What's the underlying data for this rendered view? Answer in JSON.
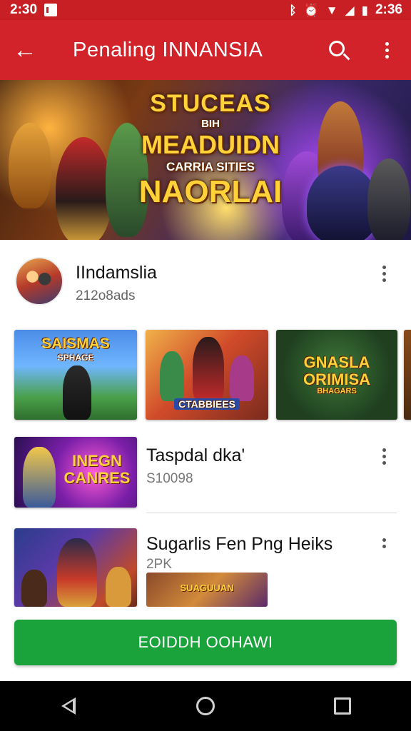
{
  "status_bar": {
    "time_left": "2:30",
    "time_right": "2:36",
    "icons": [
      "notification-icon",
      "bluetooth-icon",
      "alarm-icon",
      "wifi-icon",
      "signal-icon",
      "battery-icon"
    ]
  },
  "app_bar": {
    "title": "Penaling INNANSIA",
    "back_icon": "arrow-left-icon",
    "search_icon": "search-icon",
    "menu_icon": "more-vert-icon",
    "color": "#d2232a"
  },
  "banner": {
    "line1": "STUCEAS",
    "line2": "BIH",
    "line3": "MEADUIDN",
    "line4": "CARRIA SITIES",
    "line5": "NAORLAI"
  },
  "channel": {
    "name": "IIndamslia",
    "subscribers": "212o8ads"
  },
  "thumbnails": [
    {
      "caption": "SAISMAS",
      "subcaption": "SPHAGE"
    },
    {
      "caption": "CTABBIEES"
    },
    {
      "caption": "GNASLA ORIMISA",
      "subcaption": "BHAGARS"
    }
  ],
  "videos": [
    {
      "thumb_caption": "INEGN CANRES",
      "title": "Taspdal dka'",
      "meta": "S10098"
    },
    {
      "title": "Sugarlis Fen Png Heiks",
      "meta": "2PK",
      "thumb_caption": "SUAGUUAN"
    }
  ],
  "cta": {
    "label": "EOIDDH OOHAWI",
    "color": "#1aa33a"
  },
  "nav_bar": {
    "icons": [
      "back-nav-icon",
      "home-nav-icon",
      "recents-nav-icon"
    ]
  }
}
